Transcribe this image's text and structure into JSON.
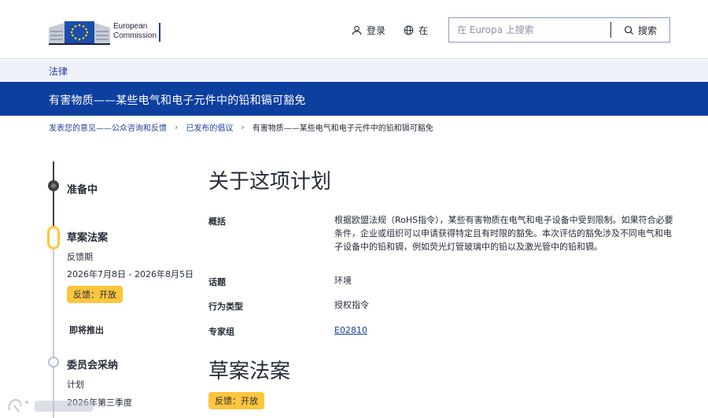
{
  "header": {
    "logo_text_line1": "European",
    "logo_text_line2": "Commission",
    "login_label": "登录",
    "lang_label": "在",
    "search": {
      "placeholder": "在 Europa 上搜索",
      "button_label": "搜索"
    }
  },
  "site": {
    "name": "法律"
  },
  "banner": {
    "title": "有害物质——某些电气和电子元件中的铅和镉可豁免"
  },
  "breadcrumb": {
    "items": [
      "发表您的意见——公众咨询和反馈",
      "已发布的倡议"
    ],
    "current": "有害物质——某些电气和电子元件中的铅和镉可豁免"
  },
  "timeline": {
    "stage1": {
      "title": "准备中"
    },
    "stage2": {
      "title": "草案法案",
      "subtitle": "反馈期",
      "dates": "2026年7月8日 - 2026年8月5日",
      "badge": "反馈：开放"
    },
    "upcoming": {
      "label": "即将推出"
    },
    "stage3": {
      "title": "委员会采纳",
      "subtitle": "计划",
      "dates": "2026年第三季度"
    }
  },
  "main": {
    "about_heading": "关于这项计划",
    "summary_label": "概括",
    "summary_text": "根据欧盟法规（RoHS指令），某些有害物质在电气和电子设备中受到限制。如果符合必要条件，企业或组织可以申请获得特定且有时限的豁免。本次评估的豁免涉及不同电气和电子设备中的铅和镉，例如荧光灯管玻璃中的铅以及激光管中的铅和镉。",
    "topic_label": "话题",
    "topic_value": "环境",
    "act_type_label": "行为类型",
    "act_type_value": "授权指令",
    "expert_group_label": "专家组",
    "expert_group_value": "E02810",
    "draft_heading": "草案法案",
    "draft_badge": "反馈：开放"
  },
  "colors": {
    "banner_blue": "#0d3f9f",
    "link_blue": "#1e3d9c",
    "badge_yellow": "#ffc53d",
    "strip_bg": "#eff1f9"
  }
}
